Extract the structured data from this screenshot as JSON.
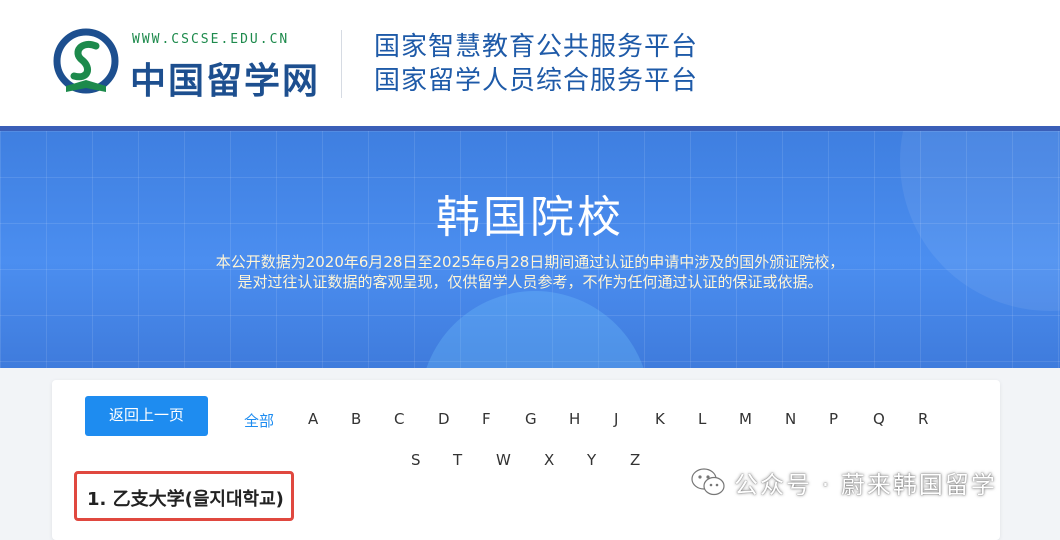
{
  "header": {
    "logo_url_text": "WWW.CSCSE.EDU.CN",
    "logo_name": "中国留学网",
    "title_line1": "国家智慧教育公共服务平台",
    "title_line2": "国家留学人员综合服务平台"
  },
  "banner": {
    "title": "韩国院校",
    "desc_line1": "本公开数据为2020年6月28日至2025年6月28日期间通过认证的申请中涉及的国外颁证院校，",
    "desc_line2": "是对过往认证数据的客观呈现，仅供留学人员参考，不作为任何通过认证的保证或依据。"
  },
  "filter": {
    "back_label": "返回上一页",
    "all_label": "全部",
    "letters_row1": [
      "A",
      "B",
      "C",
      "D",
      "F",
      "G",
      "H",
      "J",
      "K",
      "L",
      "M",
      "N",
      "P",
      "Q",
      "R"
    ],
    "letters_row2": [
      "S",
      "T",
      "W",
      "X",
      "Y",
      "Z"
    ]
  },
  "list": {
    "first_item": "1.  乙支大学(을지대학교)"
  },
  "watermark": {
    "text": "公众号 · 蔚来韩国留学"
  },
  "colors": {
    "accent": "#1e8cf0",
    "brand_blue": "#1e5aa8",
    "highlight_border": "#e0483f",
    "banner_blue": "#4b8ef0"
  }
}
